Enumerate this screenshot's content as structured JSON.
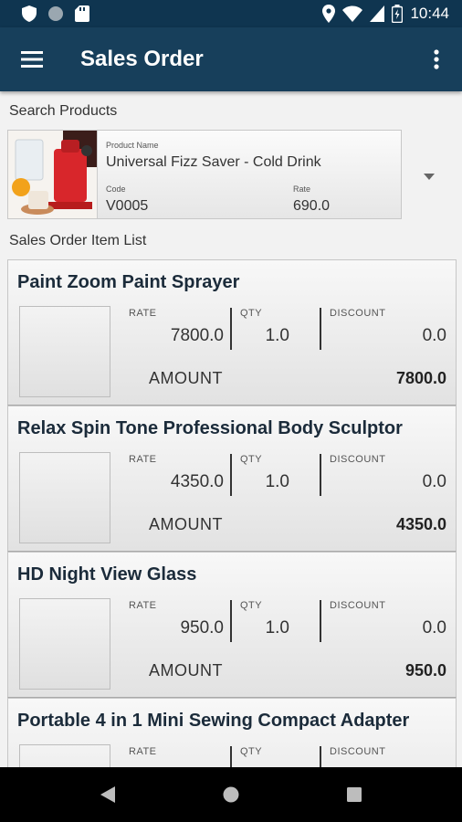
{
  "status_bar": {
    "time": "10:44"
  },
  "app_bar": {
    "title": "Sales Order"
  },
  "search": {
    "label": "Search Products"
  },
  "product": {
    "name_label": "Product Name",
    "name": "Universal Fizz Saver - Cold Drink",
    "code_label": "Code",
    "code": "V0005",
    "rate_label": "Rate",
    "rate": "690.0"
  },
  "list": {
    "label": "Sales Order Item List"
  },
  "columns": {
    "rate": "RATE",
    "qty": "QTY",
    "discount": "DISCOUNT",
    "amount": "AMOUNT"
  },
  "items": [
    {
      "name": "Paint Zoom Paint Sprayer",
      "rate": "7800.0",
      "qty": "1.0",
      "discount": "0.0",
      "amount": "7800.0"
    },
    {
      "name": "Relax Spin Tone Professional Body Sculptor",
      "rate": "4350.0",
      "qty": "1.0",
      "discount": "0.0",
      "amount": "4350.0"
    },
    {
      "name": "HD Night View Glass",
      "rate": "950.0",
      "qty": "1.0",
      "discount": "0.0",
      "amount": "950.0"
    },
    {
      "name": "Portable 4 in 1 Mini Sewing Compact Adapter",
      "rate": "",
      "qty": "",
      "discount": "",
      "amount": ""
    }
  ],
  "icons": {
    "menu": "hamburger-menu-icon",
    "more": "more-vert-icon",
    "dropdown": "arrow-drop-down-icon",
    "nav_back": "back-triangle-icon",
    "nav_home": "home-circle-icon",
    "nav_recents": "recents-square-icon"
  },
  "colors": {
    "status_bar": "#0f3550",
    "app_bar": "#173f5b",
    "nav_bar": "#000000"
  }
}
